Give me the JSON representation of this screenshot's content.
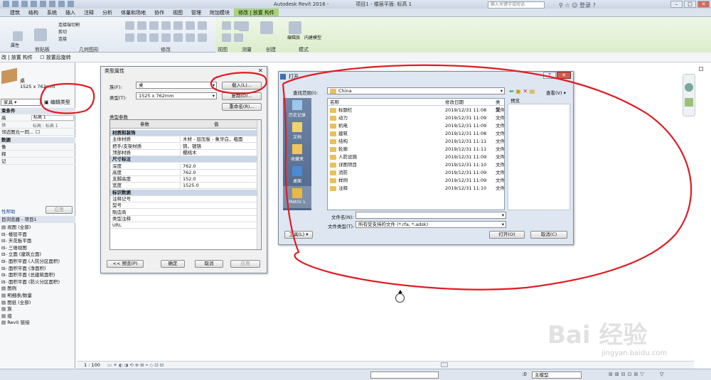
{
  "app": {
    "title": "Autodesk Revit 2016 -",
    "document": "项目1 - 楼层平面: 标高 1",
    "search_placeholder": "输入关键字或短语",
    "login": "登录"
  },
  "ribbon_tabs": [
    "建筑",
    "结构",
    "系统",
    "插入",
    "注释",
    "分析",
    "体量和场地",
    "协作",
    "视图",
    "管理",
    "附加模块",
    "修改 | 放置 构件"
  ],
  "ribbon_panels": [
    "剪贴板",
    "几何图形",
    "修改",
    "视图",
    "测量",
    "创建",
    "模式"
  ],
  "ribbon_labels": {
    "props": "属性",
    "paste": "粘贴",
    "edit_family": "编辑族",
    "inplace": "内建模型",
    "connect": "连接端切割",
    "cut": "剪切",
    "join": "连接"
  },
  "options_bar": {
    "context": "改 | 放置 构件",
    "rotate_after": "放置后旋转"
  },
  "properties": {
    "family": "桌",
    "type": "1525 x 762mm",
    "category_row": "家具",
    "edit_type": "编辑类型",
    "constraints": "束条件",
    "level_label": "高",
    "level_value": "标高 1",
    "host_label": "体",
    "host_value": "标高 : 标高 1",
    "move_with": "邻近图元一同...",
    "data_head": "数据",
    "row_a": "像",
    "row_b": "释",
    "row_c": "记",
    "help": "性帮助",
    "apply": "应用"
  },
  "browser": {
    "title": "目浏览器 - 项目1",
    "items": [
      "视图 (全部)",
      "楼层平面",
      "天花板平面",
      "三维视图",
      "立面 (建筑立面)",
      "面积平面 (人防分区面积)",
      "面积平面 (净面积)",
      "面积平面 (总建筑面积)",
      "面积平面 (防火分区面积)",
      "图例",
      "明细表/数量",
      "图纸 (全部)",
      "族",
      "组",
      "Revit 链接"
    ]
  },
  "type_dialog": {
    "title": "类型属性",
    "family_label": "族(F):",
    "family_value": "桌",
    "type_label": "类型(T):",
    "type_value": "1525 x 762mm",
    "load_btn": "载入(L)...",
    "copy_btn": "复制(D)...",
    "rename_btn": "重命名(R)...",
    "params_label": "类型参数",
    "col_param": "参数",
    "col_value": "值",
    "groups": [
      {
        "name": "材质和装饰",
        "rows": [
          [
            "主体材质",
            "木材 - 层压板 - 象牙白，粗面"
          ],
          [
            "把手/支架材质",
            "铜，镀铬"
          ],
          [
            "顶部材质",
            "樱桃木"
          ]
        ]
      },
      {
        "name": "尺寸标注",
        "rows": [
          [
            "深度",
            "762.0"
          ],
          [
            "高度",
            "762.0"
          ],
          [
            "支脚高度",
            "152.0"
          ],
          [
            "宽度",
            "1525.0"
          ]
        ]
      },
      {
        "name": "标识数据",
        "rows": [
          [
            "注释记号",
            ""
          ],
          [
            "型号",
            ""
          ],
          [
            "制造商",
            ""
          ],
          [
            "类型注释",
            ""
          ],
          [
            "URL",
            ""
          ]
        ]
      }
    ],
    "preview_btn": "<< 预览(P)",
    "ok_btn": "确定",
    "cancel_btn": "取消",
    "apply_btn": "应用"
  },
  "open_dialog": {
    "title": "打开",
    "lookin_label": "查找范围(I):",
    "lookin_value": "China",
    "view_label": "查看(V)",
    "preview_label": "预览",
    "places": [
      "历史记录",
      "文档",
      "收藏夹",
      "桌面",
      "Metric L"
    ],
    "col_name": "名称",
    "col_date": "修改日期",
    "col_type": "类型",
    "files": [
      [
        "标题栏",
        "2019/12/31 11:08",
        "文件"
      ],
      [
        "动力",
        "2019/12/31 11:09",
        "文件"
      ],
      [
        "机电",
        "2019/12/31 11:09",
        "文件"
      ],
      [
        "建筑",
        "2019/12/31 11:08",
        "文件"
      ],
      [
        "结构",
        "2019/12/31 11:11",
        "文件"
      ],
      [
        "轮廓",
        "2019/12/31 11:11",
        "文件"
      ],
      [
        "人防设施",
        "2019/12/31 11:09",
        "文件"
      ],
      [
        "详图项目",
        "2019/12/31 11:10",
        "文件"
      ],
      [
        "消防",
        "2019/12/31 11:09",
        "文件"
      ],
      [
        "样例",
        "2019/12/31 11:09",
        "文件"
      ],
      [
        "注释",
        "2019/12/31 11:10",
        "文件"
      ]
    ],
    "filename_label": "文件名(N):",
    "filetype_label": "文件类型(T):",
    "filetype_value": "所有受支持的文件 (*.rfa, *.adsk)",
    "tools_btn": "工具(L)",
    "open_btn": "打开(O)",
    "cancel_btn": "取消(C)"
  },
  "view_bar": {
    "scale": "1 : 100"
  },
  "status_bar": {
    "model": "主模型",
    "zero": ":0"
  },
  "watermark": {
    "brand": "Bai 经验",
    "url": "jingyan.baidu.com"
  },
  "annotation_color": "#e01b24"
}
